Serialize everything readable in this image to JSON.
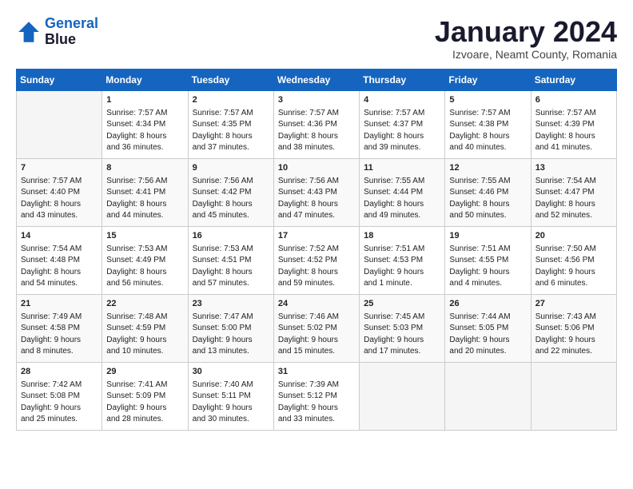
{
  "logo": {
    "line1": "General",
    "line2": "Blue"
  },
  "title": "January 2024",
  "subtitle": "Izvoare, Neamt County, Romania",
  "weekdays": [
    "Sunday",
    "Monday",
    "Tuesday",
    "Wednesday",
    "Thursday",
    "Friday",
    "Saturday"
  ],
  "weeks": [
    [
      {
        "day": "",
        "info": ""
      },
      {
        "day": "1",
        "info": "Sunrise: 7:57 AM\nSunset: 4:34 PM\nDaylight: 8 hours\nand 36 minutes."
      },
      {
        "day": "2",
        "info": "Sunrise: 7:57 AM\nSunset: 4:35 PM\nDaylight: 8 hours\nand 37 minutes."
      },
      {
        "day": "3",
        "info": "Sunrise: 7:57 AM\nSunset: 4:36 PM\nDaylight: 8 hours\nand 38 minutes."
      },
      {
        "day": "4",
        "info": "Sunrise: 7:57 AM\nSunset: 4:37 PM\nDaylight: 8 hours\nand 39 minutes."
      },
      {
        "day": "5",
        "info": "Sunrise: 7:57 AM\nSunset: 4:38 PM\nDaylight: 8 hours\nand 40 minutes."
      },
      {
        "day": "6",
        "info": "Sunrise: 7:57 AM\nSunset: 4:39 PM\nDaylight: 8 hours\nand 41 minutes."
      }
    ],
    [
      {
        "day": "7",
        "info": "Sunrise: 7:57 AM\nSunset: 4:40 PM\nDaylight: 8 hours\nand 43 minutes."
      },
      {
        "day": "8",
        "info": "Sunrise: 7:56 AM\nSunset: 4:41 PM\nDaylight: 8 hours\nand 44 minutes."
      },
      {
        "day": "9",
        "info": "Sunrise: 7:56 AM\nSunset: 4:42 PM\nDaylight: 8 hours\nand 45 minutes."
      },
      {
        "day": "10",
        "info": "Sunrise: 7:56 AM\nSunset: 4:43 PM\nDaylight: 8 hours\nand 47 minutes."
      },
      {
        "day": "11",
        "info": "Sunrise: 7:55 AM\nSunset: 4:44 PM\nDaylight: 8 hours\nand 49 minutes."
      },
      {
        "day": "12",
        "info": "Sunrise: 7:55 AM\nSunset: 4:46 PM\nDaylight: 8 hours\nand 50 minutes."
      },
      {
        "day": "13",
        "info": "Sunrise: 7:54 AM\nSunset: 4:47 PM\nDaylight: 8 hours\nand 52 minutes."
      }
    ],
    [
      {
        "day": "14",
        "info": "Sunrise: 7:54 AM\nSunset: 4:48 PM\nDaylight: 8 hours\nand 54 minutes."
      },
      {
        "day": "15",
        "info": "Sunrise: 7:53 AM\nSunset: 4:49 PM\nDaylight: 8 hours\nand 56 minutes."
      },
      {
        "day": "16",
        "info": "Sunrise: 7:53 AM\nSunset: 4:51 PM\nDaylight: 8 hours\nand 57 minutes."
      },
      {
        "day": "17",
        "info": "Sunrise: 7:52 AM\nSunset: 4:52 PM\nDaylight: 8 hours\nand 59 minutes."
      },
      {
        "day": "18",
        "info": "Sunrise: 7:51 AM\nSunset: 4:53 PM\nDaylight: 9 hours\nand 1 minute."
      },
      {
        "day": "19",
        "info": "Sunrise: 7:51 AM\nSunset: 4:55 PM\nDaylight: 9 hours\nand 4 minutes."
      },
      {
        "day": "20",
        "info": "Sunrise: 7:50 AM\nSunset: 4:56 PM\nDaylight: 9 hours\nand 6 minutes."
      }
    ],
    [
      {
        "day": "21",
        "info": "Sunrise: 7:49 AM\nSunset: 4:58 PM\nDaylight: 9 hours\nand 8 minutes."
      },
      {
        "day": "22",
        "info": "Sunrise: 7:48 AM\nSunset: 4:59 PM\nDaylight: 9 hours\nand 10 minutes."
      },
      {
        "day": "23",
        "info": "Sunrise: 7:47 AM\nSunset: 5:00 PM\nDaylight: 9 hours\nand 13 minutes."
      },
      {
        "day": "24",
        "info": "Sunrise: 7:46 AM\nSunset: 5:02 PM\nDaylight: 9 hours\nand 15 minutes."
      },
      {
        "day": "25",
        "info": "Sunrise: 7:45 AM\nSunset: 5:03 PM\nDaylight: 9 hours\nand 17 minutes."
      },
      {
        "day": "26",
        "info": "Sunrise: 7:44 AM\nSunset: 5:05 PM\nDaylight: 9 hours\nand 20 minutes."
      },
      {
        "day": "27",
        "info": "Sunrise: 7:43 AM\nSunset: 5:06 PM\nDaylight: 9 hours\nand 22 minutes."
      }
    ],
    [
      {
        "day": "28",
        "info": "Sunrise: 7:42 AM\nSunset: 5:08 PM\nDaylight: 9 hours\nand 25 minutes."
      },
      {
        "day": "29",
        "info": "Sunrise: 7:41 AM\nSunset: 5:09 PM\nDaylight: 9 hours\nand 28 minutes."
      },
      {
        "day": "30",
        "info": "Sunrise: 7:40 AM\nSunset: 5:11 PM\nDaylight: 9 hours\nand 30 minutes."
      },
      {
        "day": "31",
        "info": "Sunrise: 7:39 AM\nSunset: 5:12 PM\nDaylight: 9 hours\nand 33 minutes."
      },
      {
        "day": "",
        "info": ""
      },
      {
        "day": "",
        "info": ""
      },
      {
        "day": "",
        "info": ""
      }
    ]
  ]
}
